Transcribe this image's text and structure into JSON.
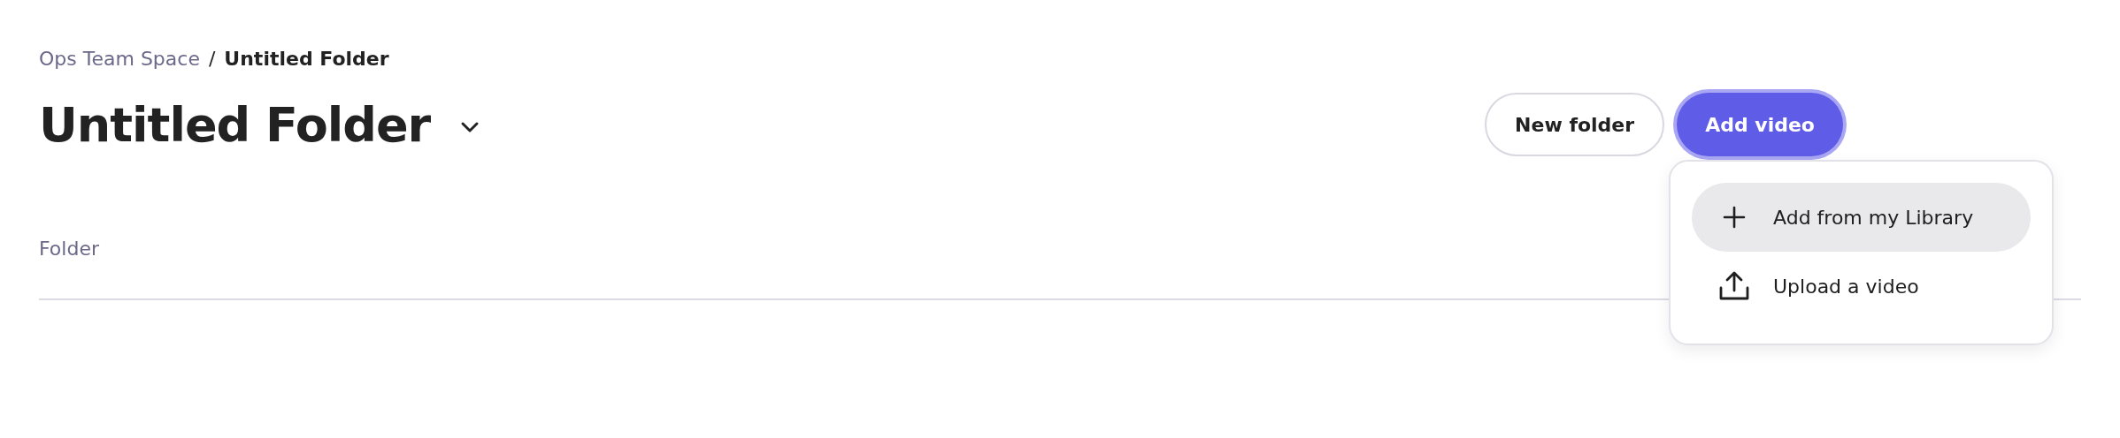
{
  "breadcrumb": {
    "parent": "Ops Team Space",
    "separator": "/",
    "current": "Untitled Folder"
  },
  "title": "Untitled Folder",
  "buttons": [
    {
      "label": "New folder",
      "kind": "secondary"
    },
    {
      "label": "Add video",
      "kind": "primary"
    }
  ],
  "menu": {
    "items": [
      {
        "label": "Add from my Library",
        "kind": "plus",
        "selected": true
      },
      {
        "label": "Upload a video",
        "kind": "upload",
        "selected": false
      }
    ]
  },
  "section_label": "Folder"
}
